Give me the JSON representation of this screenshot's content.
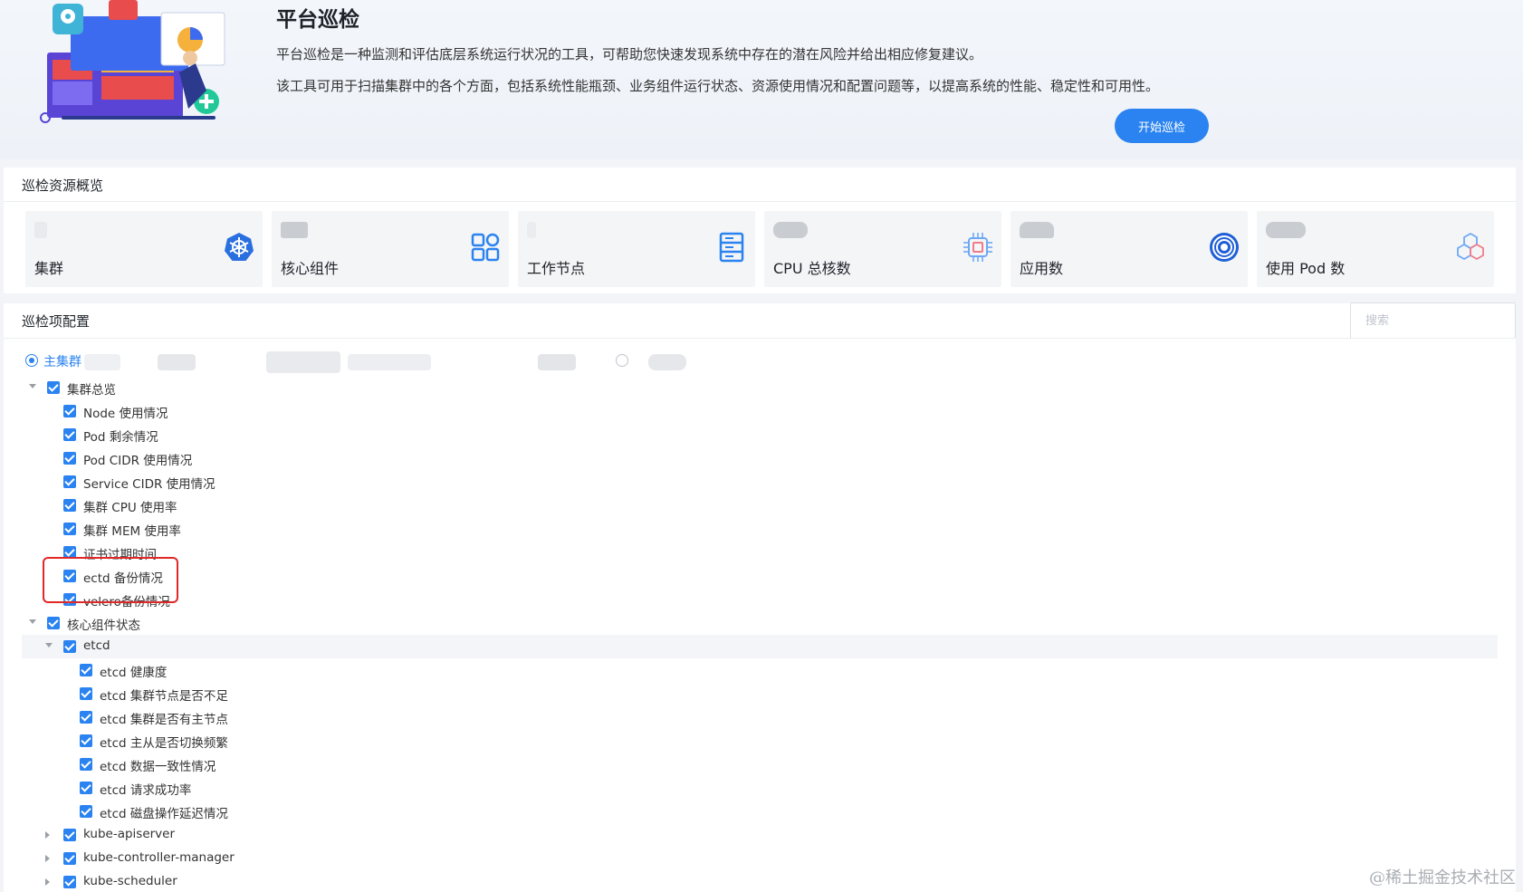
{
  "banner": {
    "title": "平台巡检",
    "desc1": "平台巡检是一种监测和评估底层系统运行状况的工具，可帮助您快速发现系统中存在的潜在风险并给出相应修复建议。",
    "desc2": "该工具可用于扫描集群中的各个方面，包括系统性能瓶颈、业务组件运行状态、资源使用情况和配置问题等，以提高系统的性能、稳定性和可用性。",
    "start_button": "开始巡检"
  },
  "overview": {
    "title": "巡检资源概览",
    "cards": [
      {
        "label": "集群",
        "icon": "kubernetes-icon"
      },
      {
        "label": "核心组件",
        "icon": "components-grid-icon"
      },
      {
        "label": "工作节点",
        "icon": "server-icon"
      },
      {
        "label": "CPU 总核数",
        "icon": "cpu-chip-icon"
      },
      {
        "label": "应用数",
        "icon": "app-swirl-icon"
      },
      {
        "label": "使用 Pod 数",
        "icon": "pod-hexagon-icon"
      }
    ]
  },
  "config": {
    "title": "巡检项配置",
    "search_placeholder": "搜索",
    "selected_cluster": "主集群",
    "tree": [
      {
        "label": "集群总览",
        "level": 1,
        "caret": "down"
      },
      {
        "label": "Node 使用情况",
        "level": 2
      },
      {
        "label": "Pod 剩余情况",
        "level": 2
      },
      {
        "label": "Pod CIDR 使用情况",
        "level": 2
      },
      {
        "label": "Service CIDR 使用情况",
        "level": 2
      },
      {
        "label": "集群 CPU 使用率",
        "level": 2
      },
      {
        "label": "集群 MEM 使用率",
        "level": 2
      },
      {
        "label": "证书过期时间",
        "level": 2
      },
      {
        "label": "ectd 备份情况",
        "level": 2
      },
      {
        "label": "velero备份情况",
        "level": 2
      },
      {
        "label": "核心组件状态",
        "level": 1,
        "caret": "down"
      },
      {
        "label": "etcd",
        "level": 2,
        "caret": "down",
        "highlight": true
      },
      {
        "label": "etcd 健康度",
        "level": 3
      },
      {
        "label": "etcd 集群节点是否不足",
        "level": 3
      },
      {
        "label": "etcd 集群是否有主节点",
        "level": 3
      },
      {
        "label": "etcd 主从是否切换频繁",
        "level": 3
      },
      {
        "label": "etcd 数据一致性情况",
        "level": 3
      },
      {
        "label": "etcd 请求成功率",
        "level": 3
      },
      {
        "label": "etcd 磁盘操作延迟情况",
        "level": 3
      },
      {
        "label": "kube-apiserver",
        "level": 2,
        "caret": "right"
      },
      {
        "label": "kube-controller-manager",
        "level": 2,
        "caret": "right"
      },
      {
        "label": "kube-scheduler",
        "level": 2,
        "caret": "right"
      }
    ]
  },
  "watermark": "@稀土掘金技术社区",
  "colors": {
    "accent": "#2a83f0",
    "highlight_box": "#e02828"
  }
}
